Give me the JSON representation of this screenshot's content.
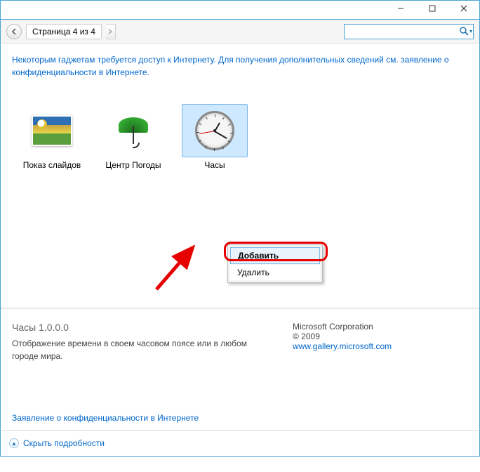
{
  "titlebar": {
    "minimize": "—",
    "maximize": "☐",
    "close": "✕"
  },
  "toolbar": {
    "page_label": "Страница 4 из 4",
    "search_placeholder": ""
  },
  "hint": "Некоторым гаджетам требуется доступ к Интернету. Для получения дополнительных сведений см. заявление о конфиденциальности в Интернете.",
  "gadgets": [
    {
      "label": "Показ слайдов"
    },
    {
      "label": "Центр Погоды"
    },
    {
      "label": "Часы"
    }
  ],
  "context_menu": {
    "add": "Добавить",
    "delete": "Удалить"
  },
  "details": {
    "title": "Часы 1.0.0.0",
    "desc": "Отображение времени в своем часовом поясе или в любом городе мира.",
    "vendor": "Microsoft Corporation",
    "copyright": "© 2009",
    "link": "www.gallery.microsoft.com"
  },
  "privacy_link": "Заявление о конфиденциальности в Интернете",
  "footer": {
    "collapse": "Скрыть подробности"
  }
}
